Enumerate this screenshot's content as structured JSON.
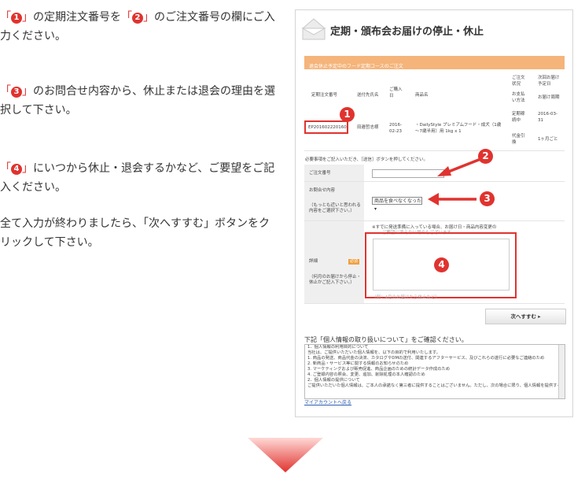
{
  "instructions": {
    "p1": {
      "n1": "❶",
      "pre": "「",
      "post": "」の定期注文番号を「",
      "n2": "❷",
      "post2": "」のご注文番号の欄にご入力ください。"
    },
    "p2": {
      "pre": "「",
      "n": "❸",
      "post": "」のお問合せ内容から、休止または退会の理由を選択して下さい。"
    },
    "p3": {
      "pre": "「",
      "n": "❹",
      "post": "」にいつから休止・退会するかなど、ご要望をご記入ください。"
    },
    "p4": "全て入力が終わりましたら、「次へすすむ」ボタンをクリックして下さい。"
  },
  "screen": {
    "title": "定期・頒布会お届けの停止・休止",
    "header_bar": "退会休止予定中のフード定期コースのご注文",
    "columns": {
      "order_no": "定期注文番号",
      "recipient": "送付先氏名",
      "purchase": [
        "ご購入",
        "日"
      ],
      "product": "商品名",
      "status": [
        "ご注文",
        "状況"
      ],
      "payment": [
        "お支払",
        "い方法"
      ],
      "next_delivery": [
        "次回お届け",
        "予定日"
      ],
      "cycle": "お届け周期"
    },
    "row": {
      "order_no": "EP201602220160",
      "recipient": "田邉哲志様",
      "date": [
        "2016-",
        "02-23"
      ],
      "product": [
        "・DailyStyle プレミアムフード・成犬（1歳",
        "〜7歳半用）用 1kg x 1"
      ],
      "status": [
        "定期稼",
        "続中"
      ],
      "payment": [
        "代金引",
        "換"
      ],
      "next_delivery": [
        "2016-03-",
        "31"
      ],
      "cycle": "1ヶ月ごと"
    },
    "form_note": "必要事項をご記入いただき、［送信］ボタンを押してください。",
    "order_field_label": "ご注文番号",
    "inquiry_label": "お問合せ内容",
    "inquiry_hint": [
      "（もっとも近いと思われる",
      "内容をご選択下さい。）"
    ],
    "inquiry_selected": "商品を食べなくなった",
    "detail_label": "詳細",
    "detail_hint": [
      "（何月のお届けから停止・",
      "休止かご記入下さい。）"
    ],
    "required_badge": "必須",
    "detail_note": "※すでに発送準備に入っている場合、お届け日・商品内容変更の",
    "detail_note2": "ご要望に添えない場合もございます。",
    "detail_foot": "（例：4月のお届けから休止など）",
    "next_button": "次へすすむ ▸",
    "privacy_title": "下記「個人情報の取り扱いについて」をご確認ください。",
    "privacy_text": [
      "1．個人情報の利用目的について",
      "当社は、ご提供いただいた個人情報を、以下の目的で利用いたします。",
      "1. 商品の発送、商品代金の決済、カタログやDMの送付、関連するアフターサービス、及びこれらの遂行に必要なご連絡のため",
      "2. 新商品・サービス等に関する情報のお知らせのため",
      "3. マーケティングおよび販売促進、商品企画のための統計データ作成のため",
      "4. ご登録内容の照会、変更、追加、削除処理の本人確認のため",
      "",
      "2．個人情報の提供について",
      "ご提供いただいた個人情報は、ご本人の承諾なく第三者に提供することはございません。ただし、次の場合に限り、個人情報を提供することがあります。"
    ],
    "back_link": "マイアカウントへ戻る"
  },
  "markers": {
    "m1": "1",
    "m2": "2",
    "m3": "3",
    "m4": "4"
  },
  "colors": {
    "accent": "#e0332f",
    "header": "#f5b47a"
  }
}
